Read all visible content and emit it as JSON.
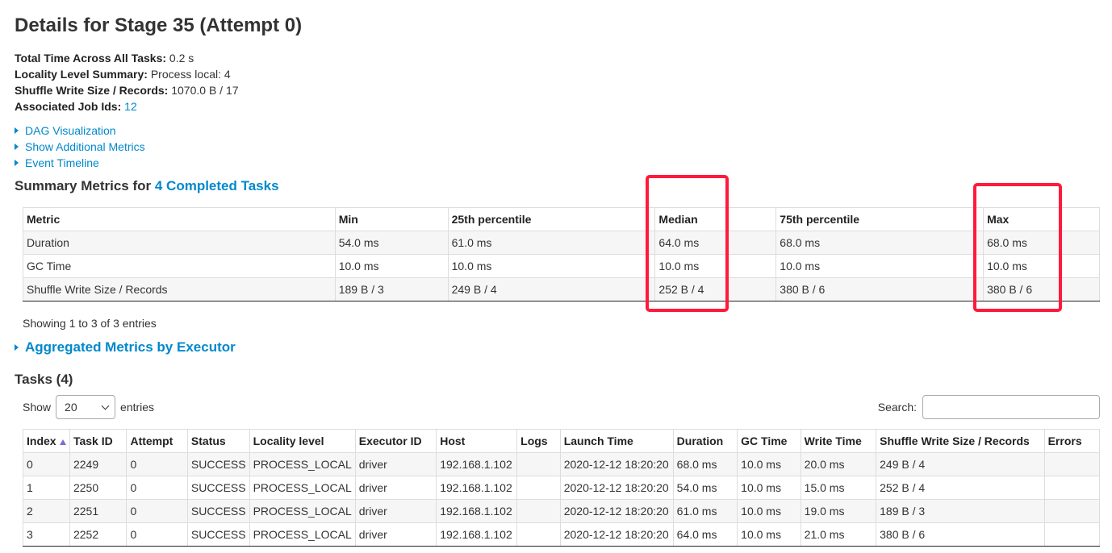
{
  "page": {
    "title": "Details for Stage 35 (Attempt 0)"
  },
  "stage_summary": [
    {
      "label": "Total Time Across All Tasks:",
      "value": "0.2 s"
    },
    {
      "label": "Locality Level Summary:",
      "value": "Process local: 4"
    },
    {
      "label": "Shuffle Write Size / Records:",
      "value": "1070.0 B / 17"
    },
    {
      "label": "Associated Job Ids:",
      "value": "12"
    }
  ],
  "expanders": [
    "DAG Visualization",
    "Show Additional Metrics",
    "Event Timeline"
  ],
  "summary_metrics": {
    "title_prefix": "Summary Metrics for",
    "title_link": "4 Completed Tasks",
    "columns": [
      "Metric",
      "Min",
      "25th percentile",
      "Median",
      "75th percentile",
      "Max"
    ],
    "rows": [
      [
        "Duration",
        "54.0 ms",
        "61.0 ms",
        "64.0 ms",
        "68.0 ms",
        "68.0 ms"
      ],
      [
        "GC Time",
        "10.0 ms",
        "10.0 ms",
        "10.0 ms",
        "10.0 ms",
        "10.0 ms"
      ],
      [
        "Shuffle Write Size / Records",
        "189 B / 3",
        "249 B / 4",
        "252 B / 4",
        "380 B / 6",
        "380 B / 6"
      ]
    ],
    "entries_info": "Showing 1 to 3 of 3 entries"
  },
  "aggregated": {
    "label": "Aggregated Metrics by Executor"
  },
  "tasks": {
    "title": "Tasks (4)",
    "show_label": "Show",
    "page_size": "20",
    "entries_label": "entries",
    "search_label": "Search:",
    "search_value": "",
    "columns": [
      "Index",
      "Task ID",
      "Attempt",
      "Status",
      "Locality level",
      "Executor ID",
      "Host",
      "Logs",
      "Launch Time",
      "Duration",
      "GC Time",
      "Write Time",
      "Shuffle Write Size / Records",
      "Errors"
    ],
    "rows": [
      [
        "0",
        "2249",
        "0",
        "SUCCESS",
        "PROCESS_LOCAL",
        "driver",
        "192.168.1.102",
        "",
        "2020-12-12 18:20:20",
        "68.0 ms",
        "10.0 ms",
        "20.0 ms",
        "249 B / 4",
        ""
      ],
      [
        "1",
        "2250",
        "0",
        "SUCCESS",
        "PROCESS_LOCAL",
        "driver",
        "192.168.1.102",
        "",
        "2020-12-12 18:20:20",
        "54.0 ms",
        "10.0 ms",
        "15.0 ms",
        "252 B / 4",
        ""
      ],
      [
        "2",
        "2251",
        "0",
        "SUCCESS",
        "PROCESS_LOCAL",
        "driver",
        "192.168.1.102",
        "",
        "2020-12-12 18:20:20",
        "61.0 ms",
        "10.0 ms",
        "19.0 ms",
        "189 B / 3",
        ""
      ],
      [
        "3",
        "2252",
        "0",
        "SUCCESS",
        "PROCESS_LOCAL",
        "driver",
        "192.168.1.102",
        "",
        "2020-12-12 18:20:20",
        "64.0 ms",
        "10.0 ms",
        "21.0 ms",
        "380 B / 6",
        ""
      ]
    ]
  },
  "colors": {
    "link": "#0088cc",
    "highlight": "#ff1a3c",
    "stripe": "#f6f6f6",
    "sort_arrow": "#7a6fd0"
  },
  "icons": {
    "expander": "triangle-right-icon",
    "sort": "sort-ascending-icon",
    "select": "chevron-down-icon"
  }
}
